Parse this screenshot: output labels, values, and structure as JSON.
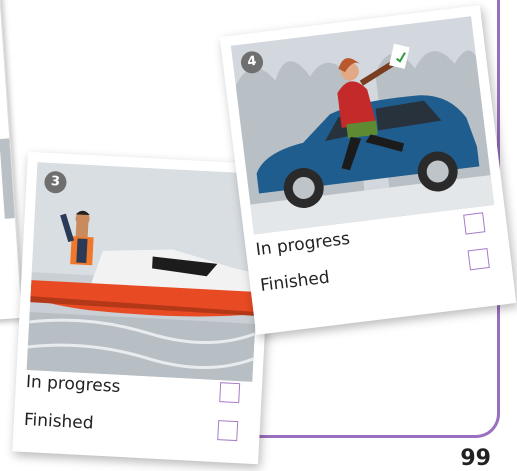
{
  "cards": [
    {
      "number": "3",
      "status_in_progress": "In progress",
      "status_finished": "Finished"
    },
    {
      "number": "4",
      "status_in_progress": "In progress",
      "status_finished": "Finished"
    }
  ],
  "page_number": "99",
  "colors": {
    "checkbox_border": "#a77cc8",
    "frame_border": "#9b6fc0"
  }
}
